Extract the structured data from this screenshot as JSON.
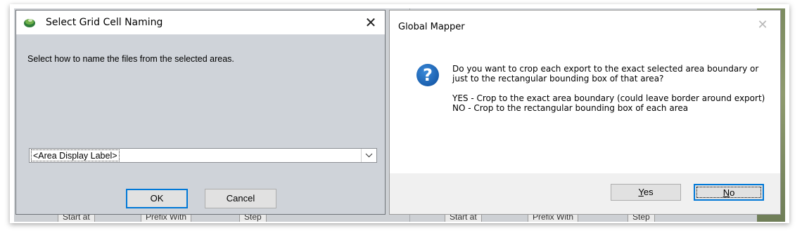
{
  "background": {
    "cells": [
      "Start at",
      "Prefix With",
      "Step",
      "Start at",
      "Prefix With",
      "Step"
    ]
  },
  "grid_dialog": {
    "title": "Select Grid Cell Naming",
    "close_glyph": "✕",
    "prompt": "Select how to name the files from the selected areas.",
    "combo_value": "<Area Display Label>",
    "ok_label": "OK",
    "cancel_label": "Cancel"
  },
  "mapper_dialog": {
    "title": "Global Mapper",
    "close_glyph": "✕",
    "icon": "question-icon",
    "icon_glyph": "?",
    "message_question": "Do you want to crop each export to the exact selected area boundary or just to the rectangular bounding box of that area?",
    "message_options": "YES - Crop to the exact area boundary (could leave border around export)\nNO - Crop to the rectangular bounding box of each area",
    "yes_label_underlined": "Y",
    "yes_label_rest": "es",
    "no_label_underlined": "N",
    "no_label_rest": "o"
  },
  "colors": {
    "dialog_gray": "#cfd3d9",
    "accent": "#0078d7",
    "question_icon": "#1a5fae"
  }
}
